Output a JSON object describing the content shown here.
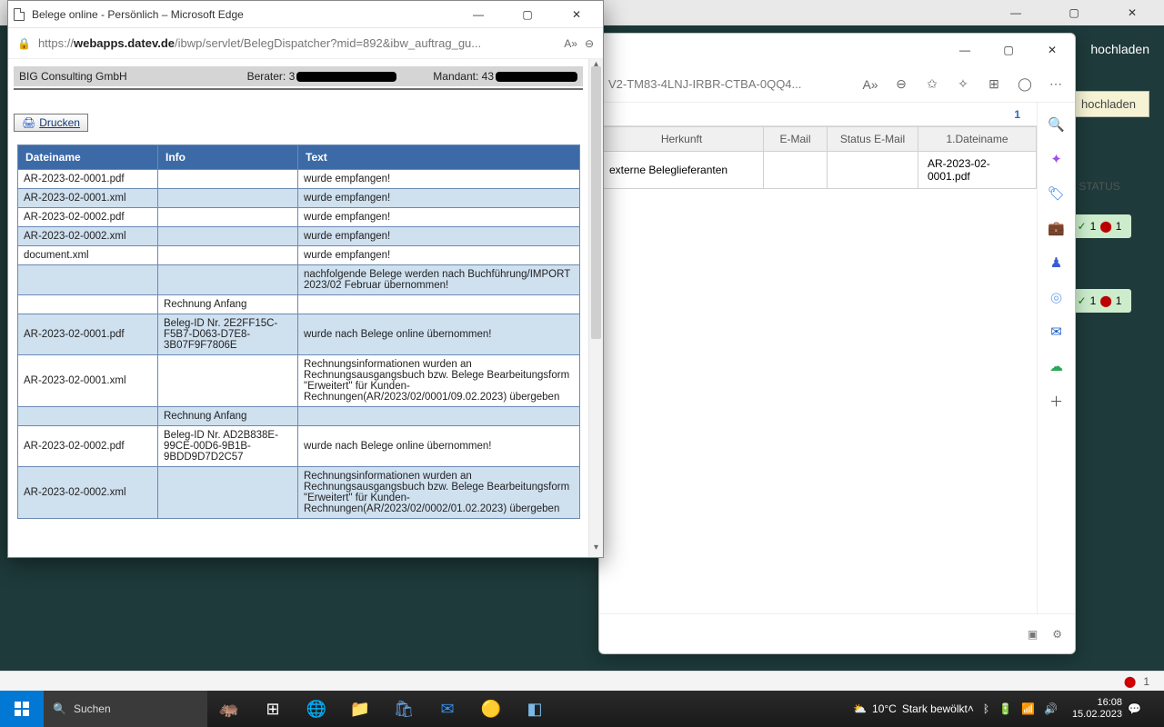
{
  "popup": {
    "title": "Belege online - Persönlich – Microsoft Edge",
    "url_prefix": "https://",
    "url_host": "webapps.datev.de",
    "url_path": "/ibwp/servlet/BelegDispatcher?mid=892&ibw_auftrag_gu...",
    "company": "BIG Consulting GmbH",
    "berater_label": "Berater: 3",
    "mandant_label": "Mandant: 43",
    "print_label": "Drucken",
    "cols": {
      "dateiname": "Dateiname",
      "info": "Info",
      "text": "Text"
    },
    "rows": [
      {
        "d": "AR-2023-02-0001.pdf",
        "i": "",
        "t": "wurde empfangen!"
      },
      {
        "d": "AR-2023-02-0001.xml",
        "i": "",
        "t": "wurde empfangen!"
      },
      {
        "d": "AR-2023-02-0002.pdf",
        "i": "",
        "t": "wurde empfangen!"
      },
      {
        "d": "AR-2023-02-0002.xml",
        "i": "",
        "t": "wurde empfangen!"
      },
      {
        "d": "document.xml",
        "i": "",
        "t": "wurde empfangen!"
      },
      {
        "d": "",
        "i": "",
        "t": "nachfolgende Belege werden nach Buchführung/IMPORT 2023/02 Februar übernommen!"
      },
      {
        "d": "",
        "i": "Rechnung Anfang",
        "t": ""
      },
      {
        "d": "AR-2023-02-0001.pdf",
        "i": "Beleg-ID Nr. 2E2FF15C-F5B7-D063-D7E8-3B07F9F7806E",
        "t": "wurde nach Belege online übernommen!"
      },
      {
        "d": "AR-2023-02-0001.xml",
        "i": "",
        "t": "Rechnungsinformationen wurden an Rechnungsausgangsbuch bzw. Belege Bearbeitungsform \"Erweitert\" für Kunden-Rechnungen(AR/2023/02/0001/09.02.2023) übergeben"
      },
      {
        "d": "",
        "i": "Rechnung Anfang",
        "t": ""
      },
      {
        "d": "AR-2023-02-0002.pdf",
        "i": "Beleg-ID Nr. AD2B838E-99CE-00D6-9B1B-9BDD9D7D2C57",
        "t": "wurde nach Belege online übernommen!"
      },
      {
        "d": "AR-2023-02-0002.xml",
        "i": "",
        "t": "Rechnungsinformationen wurden an Rechnungsausgangsbuch bzw. Belege Bearbeitungsform \"Erweitert\" für Kunden-Rechnungen(AR/2023/02/0002/01.02.2023) übergeben"
      }
    ]
  },
  "edge2": {
    "url": "V2-TM83-4LNJ-IRBR-CTBA-0QQ4...",
    "page": "1",
    "cols": {
      "herkunft": "Herkunft",
      "email": "E-Mail",
      "status": "Status E-Mail",
      "dateiname": "1.Dateiname"
    },
    "row": {
      "herkunft": "externe Beleglieferanten",
      "email": "",
      "status": "",
      "dateiname": "AR-2023-02-0001.pdf"
    }
  },
  "bg": {
    "hochladen_top": "hochladen",
    "hochladen_btn": "hochladen",
    "status_head": "STATUS",
    "chip_ok": "1",
    "chip_err": "1"
  },
  "taskbar": {
    "search": "Suchen",
    "weather_temp": "10°C",
    "weather_text": "Stark bewölkt",
    "time": "16:08",
    "date": "15.02.2023"
  },
  "notif_count": "1"
}
